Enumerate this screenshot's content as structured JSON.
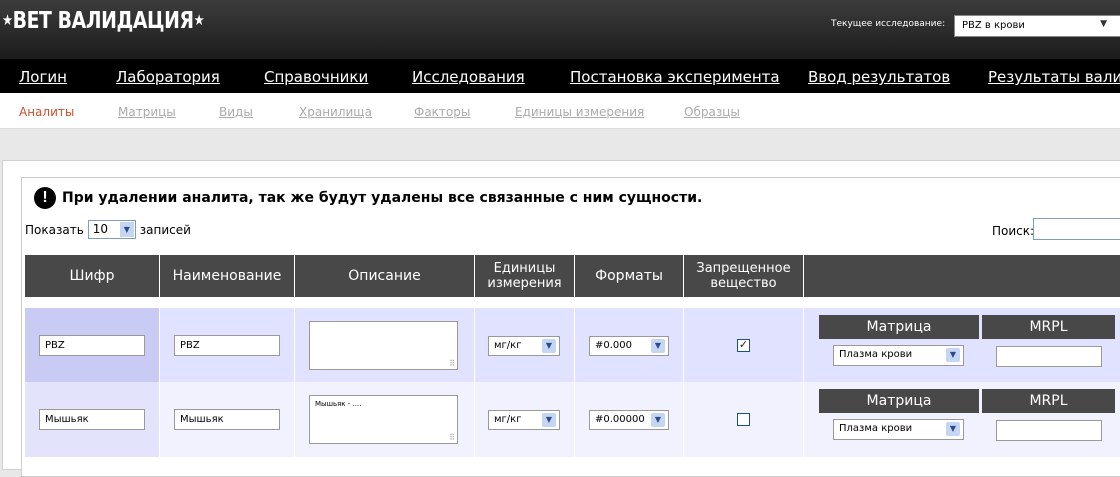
{
  "header": {
    "logo": "ВЕТ ВАЛИДАЦИЯ",
    "current_study_label": "Текущее исследование:",
    "current_study_value": "PBZ в крови"
  },
  "nav": [
    "Логин",
    "Лаборатория",
    "Справочники",
    "Исследования",
    "Постановка эксперимента",
    "Ввод результатов",
    "Результаты валида"
  ],
  "subnav": [
    "Аналиты",
    "Матрицы",
    "Виды",
    "Хранилища",
    "Факторы",
    "Единицы измерения",
    "Образцы"
  ],
  "warning": "При удалении аналита, так же будут удалены все связанные с ним сущности.",
  "length": {
    "show": "Показать",
    "value": "10",
    "records": "записей"
  },
  "search_label": "Поиск:",
  "columns": [
    "Шифр",
    "Наименование",
    "Описание",
    "Единицы измерения",
    "Форматы",
    "Запрещенное вещество"
  ],
  "rows": [
    {
      "code": "PBZ",
      "name": "PBZ",
      "description": "",
      "unit": "мг/кг",
      "format": "#0.000",
      "banned": true,
      "matrix_label": "Матрица",
      "mrpl_label": "MRPL",
      "matrix_value": "Плазма крови"
    },
    {
      "code": "Мышьяк",
      "name": "Мышьяк",
      "description": "Мышьяк - ....",
      "unit": "мг/кг",
      "format": "#0.00000",
      "banned": false,
      "matrix_label": "Матрица",
      "mrpl_label": "MRPL",
      "matrix_value": "Плазма крови"
    }
  ]
}
